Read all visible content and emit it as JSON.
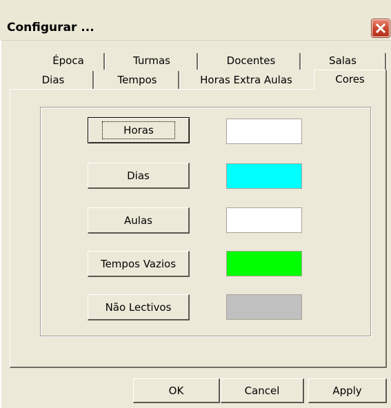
{
  "window": {
    "title": "Configurar ..."
  },
  "tabs": {
    "row1": [
      "Época",
      "Turmas",
      "Docentes",
      "Salas"
    ],
    "row2": [
      "Dias",
      "Tempos",
      "Horas Extra Aulas"
    ],
    "active": "Cores"
  },
  "colors": [
    {
      "label": "Horas",
      "color": "#ffffff"
    },
    {
      "label": "Dias",
      "color": "#00ffff"
    },
    {
      "label": "Aulas",
      "color": "#ffffff"
    },
    {
      "label": "Tempos Vazios",
      "color": "#00ff00"
    },
    {
      "label": "Não Lectivos",
      "color": "#c0c0c0"
    }
  ],
  "buttons": {
    "ok": "OK",
    "cancel": "Cancel",
    "apply": "Apply"
  }
}
